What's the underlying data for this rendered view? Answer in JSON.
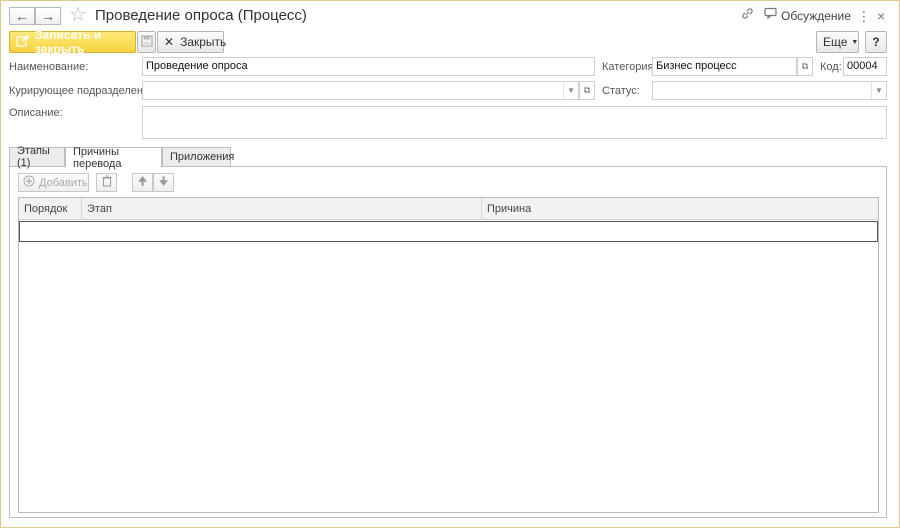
{
  "header": {
    "title": "Проведение опроса (Процесс)",
    "discuss_label": "Обсуждение"
  },
  "toolbar": {
    "save_close_label": "Записать и закрыть",
    "close_label": "Закрыть",
    "more_label": "Еще",
    "help_label": "?"
  },
  "form": {
    "name_label": "Наименование:",
    "name_value": "Проведение опроса",
    "category_label": "Категория:",
    "category_value": "Бизнес процесс",
    "code_label": "Код:",
    "code_value": "00004",
    "department_label": "Курирующее подразделение:",
    "department_value": "",
    "status_label": "Статус:",
    "status_value": "",
    "description_label": "Описание:",
    "description_value": ""
  },
  "tabs": [
    {
      "label": "Этапы (1)"
    },
    {
      "label": "Причины перевода"
    },
    {
      "label": "Приложения"
    }
  ],
  "panel": {
    "add_label": "Добавить"
  },
  "table": {
    "columns": [
      "Порядок",
      "Этап",
      "Причина"
    ]
  }
}
